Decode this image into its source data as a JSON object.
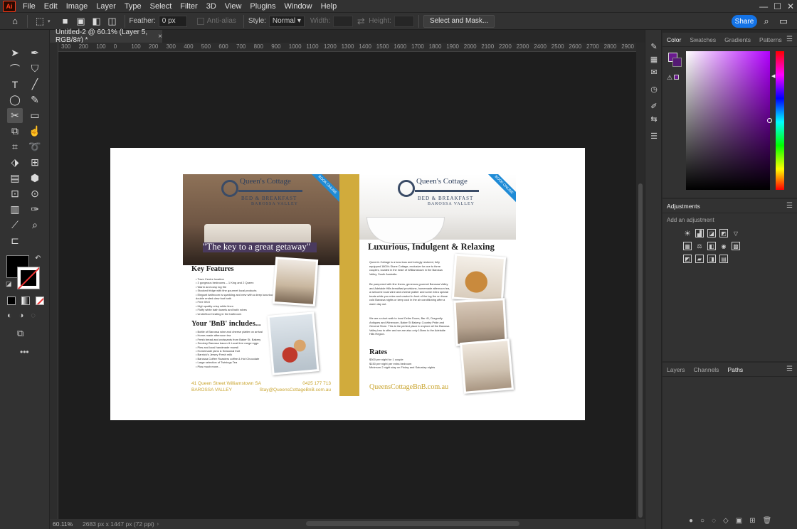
{
  "menubar": {
    "logo": "Ai",
    "items": [
      "File",
      "Edit",
      "Image",
      "Layer",
      "Type",
      "Select",
      "Filter",
      "3D",
      "View",
      "Plugins",
      "Window",
      "Help"
    ],
    "window_controls": [
      "—",
      "☐",
      "✕"
    ]
  },
  "options": {
    "feather_label": "Feather:",
    "feather_value": "0 px",
    "antialias_label": "Anti-alias",
    "style_label": "Style:",
    "style_value": "Normal",
    "width_label": "Width:",
    "height_label": "Height:",
    "select_mask_label": "Select and Mask...",
    "share_label": "Share"
  },
  "document": {
    "tab_title": "Untitled-2 @ 60.1% (Layer 5, RGB/8#) *",
    "close_glyph": "×"
  },
  "ruler": {
    "h_ticks": [
      "300",
      "200",
      "100",
      "0",
      "100",
      "200",
      "300",
      "400",
      "500",
      "600",
      "700",
      "800",
      "900",
      "1000",
      "1100",
      "1200",
      "1300",
      "1400",
      "1500",
      "1600",
      "1700",
      "1800",
      "1900",
      "2000",
      "2100",
      "2200",
      "2300",
      "2400",
      "2500",
      "2600",
      "2700",
      "2800",
      "2900"
    ]
  },
  "brochure": {
    "logo_name": "Queen's Cottage",
    "logo_sub": "BED & BREAKFAST",
    "logo_region": "BAROSSA VALLEY",
    "ribbon": "BOOK ONLINE",
    "tagline": "\"The key to a great getaway\"",
    "key_features_title": "Key Features",
    "key_features": [
      "Town Centre location",
      "3 gorgeous bedrooms – 1 King and 2 Queen",
      "Warm and cosy log fire",
      "Stocked fridge with fine gourmet local products",
      "Elegant bathroom is sparkling and new with a deep luxurious double ended claw foot bath",
      "Free Wi-fi",
      "High quality crisp white linen",
      "Fluffy white bath towels and bath robes",
      "Underfloor heating in the bathroom"
    ],
    "bnb_title": "Your 'BnB' includes...",
    "bnb_items": [
      "Bottle of Barossa wine and cheese platter on arrival",
      "Home-made afternoon tea",
      "Fresh bread and croissants from Baker St. Bakery",
      "Smokey Barossa bacon & Local free range eggs",
      "Pies and local handmade muesli",
      "Homemade jams & Seasonal fruit",
      "Barnick's Jersey Fresh milk",
      "Barossa Coffee Roasters coffee & Hot Chocolate",
      "Large selection of Twinings Tea",
      "Plus much more..."
    ],
    "address_line1": "41 Queen Street Williamstown SA",
    "address_line2": "BAROSSA VALLEY",
    "phone": "0425 177 713",
    "email": "Stay@QueensCottageBnB.com.au",
    "right_heading": "Luxurious, Indulgent & Relaxing",
    "para1": "Queen's Cottage is a luxurious and lovingly restored, fully equipped 1800's Stone Cottage, exclusive for one to three couples, located in the heart of Williamstown in the Barossa Valley, South Australia.",
    "para2": "Be pampered with fine linens, generous gourmet Barossa Valley and Adelaide Hills breakfast provisions, homemade afternoon tea, a welcome local wine and cheese platter and some extra special treats while you relax and unwind in front of the log fire on those cold Barossa nights or keep cool in the air conditioning after a warm day out.",
    "para3": "We are a short walk to local Cellar Doors, Bar 41, Dragonfly Antiques and Wineroom, Baker St Bakery, Country Pride and General Store. This is the perfect place to explore all the Barossa Valley has to offer and we are also only 10kms to the Adelaide Hills Region.",
    "rates_title": "Rates",
    "rates": [
      "$300 per night for 1 couple",
      "$150 per night per extra bedroom",
      "Minimum 2 night stay on Friday and Saturday nights"
    ],
    "website": "QueensCottageBnB.com.au"
  },
  "status": {
    "zoom": "60.11%",
    "doc_size": "2683 px x 1447 px (72 ppi)"
  },
  "panels": {
    "color_tabs": [
      "Color",
      "Swatches",
      "Gradients",
      "Patterns"
    ],
    "adjustments_title": "Adjustments",
    "adjustments_hint": "Add an adjustment",
    "layers_tabs": [
      "Layers",
      "Channels",
      "Paths"
    ]
  },
  "colors": {
    "accent": "#1473e6",
    "foreground": "#6a1a8e",
    "gold": "#d1ab3c"
  }
}
